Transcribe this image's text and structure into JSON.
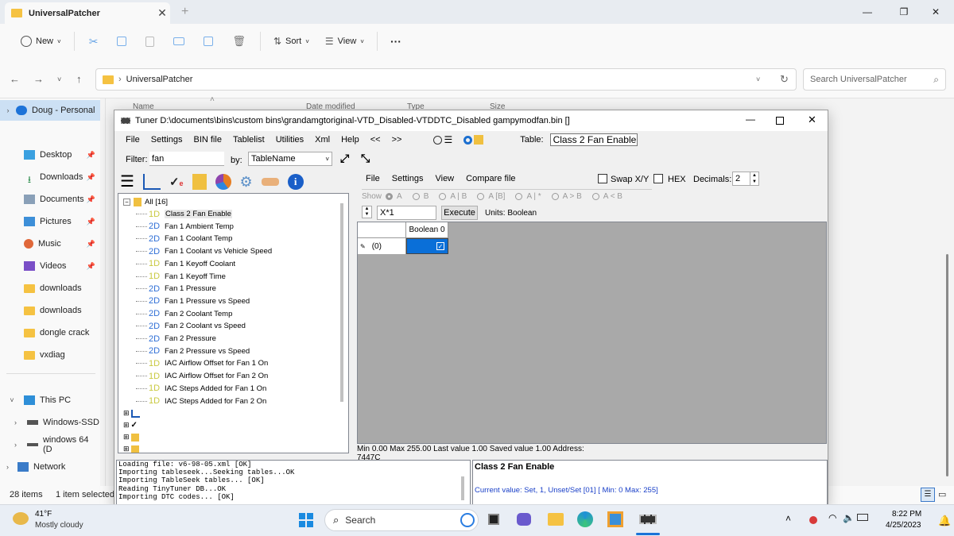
{
  "explorer": {
    "tab_title": "UniversalPatcher",
    "toolbar": {
      "new": "New",
      "sort": "Sort",
      "view": "View"
    },
    "address": "UniversalPatcher",
    "search_placeholder": "Search UniversalPatcher",
    "columns": [
      "Name",
      "Date modified",
      "Type",
      "Size"
    ],
    "sidebar": [
      {
        "label": "Doug - Personal",
        "icon": "cloud-icon",
        "pinned": false
      },
      {
        "label": "Desktop",
        "icon": "desktop-icon",
        "pinned": true
      },
      {
        "label": "Downloads",
        "icon": "download-icon",
        "pinned": true
      },
      {
        "label": "Documents",
        "icon": "document-icon",
        "pinned": true
      },
      {
        "label": "Pictures",
        "icon": "picture-icon",
        "pinned": true
      },
      {
        "label": "Music",
        "icon": "music-icon",
        "pinned": true
      },
      {
        "label": "Videos",
        "icon": "video-icon",
        "pinned": true
      },
      {
        "label": "downloads",
        "icon": "folder-icon",
        "pinned": false
      },
      {
        "label": "downloads",
        "icon": "folder-icon",
        "pinned": false
      },
      {
        "label": "dongle crack",
        "icon": "folder-icon",
        "pinned": false
      },
      {
        "label": "vxdiag",
        "icon": "folder-icon",
        "pinned": false
      },
      {
        "label": "This PC",
        "icon": "pc-icon",
        "pinned": false
      },
      {
        "label": "Windows-SSD",
        "icon": "drive-icon",
        "pinned": false
      },
      {
        "label": "windows 64 (D",
        "icon": "drive-icon",
        "pinned": false
      },
      {
        "label": "Network",
        "icon": "network-icon",
        "pinned": false
      }
    ],
    "status_items": "28 items",
    "status_selected": "1 item selected"
  },
  "tuner": {
    "title": "Tuner D:\\documents\\bins\\custom bins\\grandamgtoriginal-VTD_Disabled-VTDDTC_Disabled gampymodfan.bin []",
    "menu": [
      "File",
      "Settings",
      "BIN file",
      "Tablelist",
      "Utilities",
      "Xml",
      "Help",
      "<<",
      ">>"
    ],
    "table_label": "Table:",
    "table_value": "Class 2 Fan Enable",
    "filter_label": "Filter:",
    "filter_value": "fan",
    "by_label": "by:",
    "by_value": "TableName",
    "sub_menu": [
      "File",
      "Settings",
      "View",
      "Compare file"
    ],
    "swap_label": "Swap X/Y",
    "hex_label": "HEX",
    "decimals_label": "Decimals:",
    "decimals_value": "2",
    "show_label": "Show",
    "show_options": [
      "A",
      "B",
      "A | B",
      "A [B]",
      "A | *",
      "A > B",
      "A < B"
    ],
    "formula_value": "X*1",
    "execute_label": "Execute",
    "units": "Units: Boolean",
    "tree_root": "All [16]",
    "tree_items": [
      {
        "badge": "1D",
        "label": "Class 2 Fan Enable"
      },
      {
        "badge": "2D",
        "label": "Fan 1 Ambient Temp"
      },
      {
        "badge": "2D",
        "label": "Fan 1 Coolant Temp"
      },
      {
        "badge": "2D",
        "label": "Fan 1 Coolant vs Vehicle Speed"
      },
      {
        "badge": "1D",
        "label": "Fan 1 Keyoff Coolant"
      },
      {
        "badge": "1D",
        "label": "Fan 1 Keyoff Time"
      },
      {
        "badge": "2D",
        "label": "Fan 1 Pressure"
      },
      {
        "badge": "2D",
        "label": "Fan 1 Pressure vs Speed"
      },
      {
        "badge": "2D",
        "label": "Fan 2 Coolant Temp"
      },
      {
        "badge": "2D",
        "label": "Fan 2 Coolant vs Speed"
      },
      {
        "badge": "2D",
        "label": "Fan 2 Pressure"
      },
      {
        "badge": "2D",
        "label": "Fan 2 Pressure vs Speed"
      },
      {
        "badge": "1D",
        "label": "IAC Airflow Offset for Fan 1 On"
      },
      {
        "badge": "1D",
        "label": "IAC Airflow Offset for Fan 2 On"
      },
      {
        "badge": "1D",
        "label": "IAC Steps Added for Fan 1 On"
      },
      {
        "badge": "1D",
        "label": "IAC Steps Added for Fan 2 On"
      }
    ],
    "grid_col_header": "Boolean 0",
    "grid_row_header": "(0)",
    "info": "Min 0.00 Max 255.00 Last value 1.00 Saved value 1.00 Address: 7447C",
    "log_lines": [
      "Loading file: v6-98-05.xml [OK]",
      "Importing tableseek...Seeking tables...OK",
      "Importing TableSeek tables...  [OK]",
      "Reading TinyTuner DB...OK",
      "Importing DTC codes... [OK]"
    ],
    "desc_title": "Class 2 Fan Enable",
    "desc_value": "Current value: Set, 1, Unset/Set [01] [ Min: 0 Max: 255]"
  },
  "taskbar": {
    "weather_temp": "41°F",
    "weather_desc": "Mostly cloudy",
    "search": "Search",
    "time": "8:22 PM",
    "date": "4/25/2023"
  }
}
